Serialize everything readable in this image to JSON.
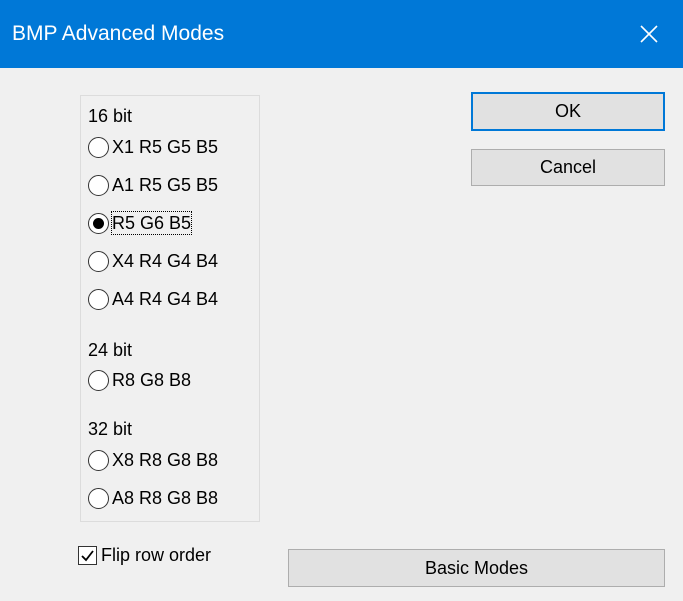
{
  "window": {
    "title": "BMP Advanced Modes",
    "accent_color": "#0078d7",
    "close_icon": "close-icon"
  },
  "group_16": {
    "label": "16 bit",
    "options": [
      {
        "label": "X1 R5 G5 B5",
        "selected": false
      },
      {
        "label": "A1 R5 G5 B5",
        "selected": false
      },
      {
        "label": "R5 G6 B5",
        "selected": true
      },
      {
        "label": "X4 R4 G4 B4",
        "selected": false
      },
      {
        "label": "A4 R4 G4 B4",
        "selected": false
      }
    ]
  },
  "group_24": {
    "label": "24 bit",
    "options": [
      {
        "label": "R8 G8 B8",
        "selected": false
      }
    ]
  },
  "group_32": {
    "label": "32 bit",
    "options": [
      {
        "label": "X8 R8 G8 B8",
        "selected": false
      },
      {
        "label": "A8 R8 G8 B8",
        "selected": false
      }
    ]
  },
  "buttons": {
    "ok": "OK",
    "cancel": "Cancel",
    "basic_modes": "Basic Modes"
  },
  "flip_row_order": {
    "label": "Flip row order",
    "checked": true
  }
}
